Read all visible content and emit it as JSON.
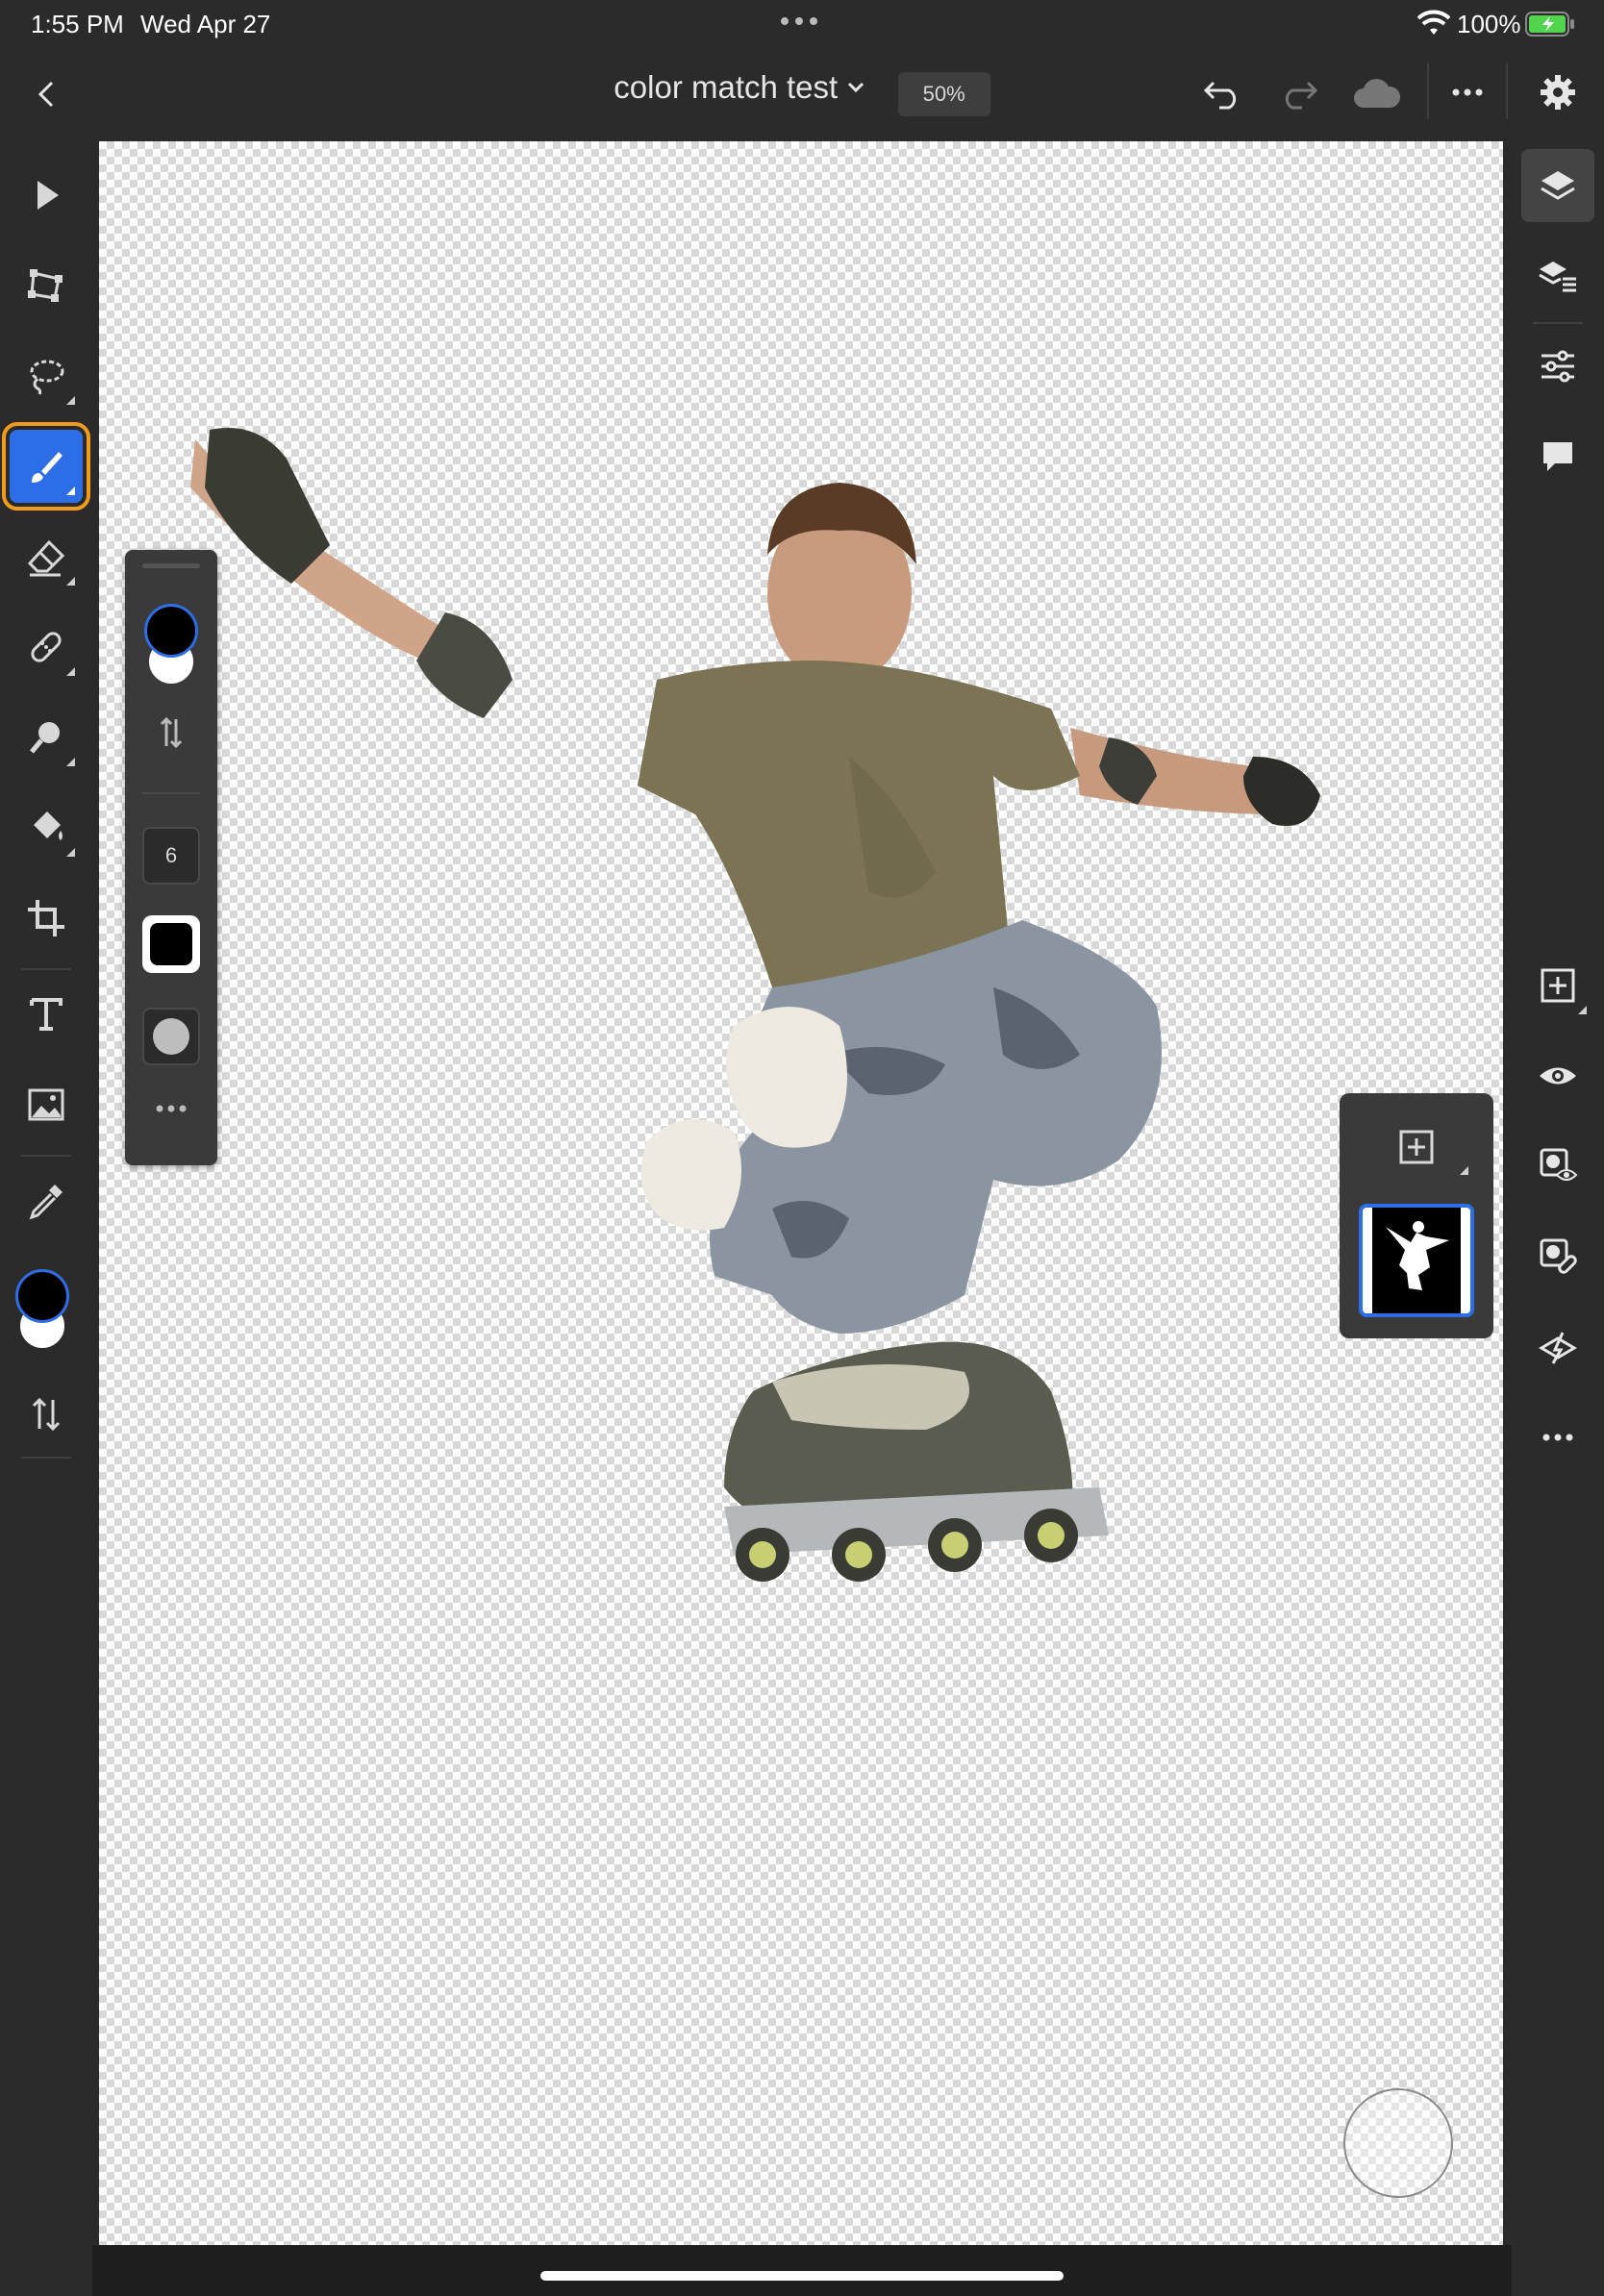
{
  "status_bar": {
    "time": "1:55 PM",
    "date": "Wed Apr 27",
    "battery": "100%"
  },
  "topbar": {
    "document_title": "color match test",
    "zoom": "50%"
  },
  "brush_panel": {
    "brush_size": "6"
  },
  "colors": {
    "accent": "#2d6ee6",
    "active_outline": "#f29a1b",
    "foreground": "#000000",
    "background": "#ffffff"
  }
}
